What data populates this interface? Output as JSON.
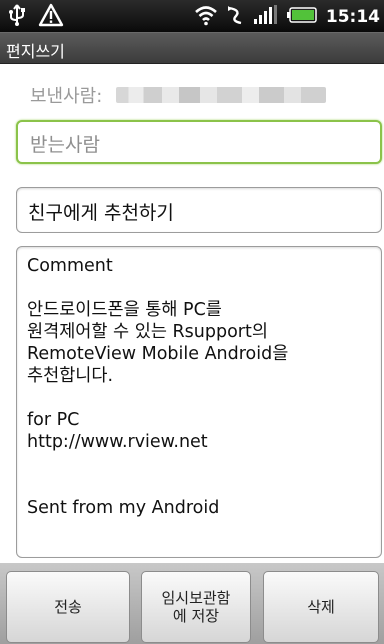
{
  "status_bar": {
    "time": "15:14",
    "icons": [
      "usb-icon",
      "warning-icon",
      "wifi-icon",
      "signal-icon",
      "battery-icon"
    ]
  },
  "title_bar": {
    "title": "편지쓰기"
  },
  "sender": {
    "label": "보낸사람:"
  },
  "recipient": {
    "placeholder": "받는사람"
  },
  "subject": {
    "value": "친구에게 추천하기"
  },
  "body": {
    "text": "Comment\n\n안드로이드폰을 통해 PC를\n원격제어할 수 있는 Rsupport의\nRemoteView Mobile Android을\n추천합니다.\n\nfor PC\nhttp://www.rview.net\n\n\nSent from my Android"
  },
  "actions": {
    "send": "전송",
    "save_draft": "임시보관함\n에 저장",
    "delete": "삭제"
  },
  "colors": {
    "focus_border": "#8bc34a",
    "status_bar": "#111111",
    "title_bar": "#4a4a4a"
  }
}
